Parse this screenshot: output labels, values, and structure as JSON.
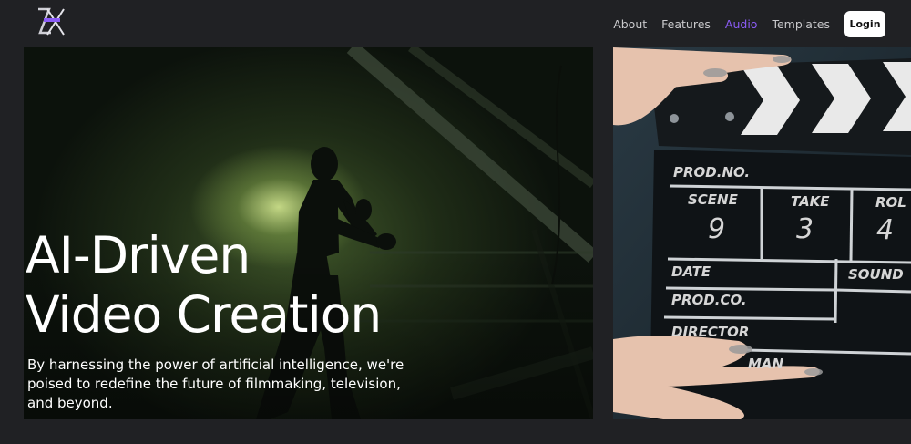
{
  "header": {
    "logo": {
      "icon": "zx-logo-icon",
      "text": "",
      "accent": "#8b5cf6"
    },
    "nav": [
      {
        "label": "About",
        "active": false
      },
      {
        "label": "Features",
        "active": false
      },
      {
        "label": "Audio",
        "active": true
      },
      {
        "label": "Templates",
        "active": false
      }
    ],
    "login_label": "Login"
  },
  "hero": {
    "title_line1": "AI-Driven",
    "title_line2": "Video Creation",
    "description": "By harnessing the power of artificial intelligence, we're poised to redefine the future of filmmaking, television, and beyond.",
    "image": "boxer-silhouette-image"
  },
  "clapboard": {
    "image": "film-clapperboard-image",
    "prod_no": "PROD.NO.",
    "scene_label": "SCENE",
    "take_label": "TAKE",
    "roll_label": "ROL",
    "scene_value": "9",
    "take_value": "3",
    "roll_value": "4",
    "date_label": "DATE",
    "sound_label": "SOUND",
    "prod_co": "PROD.CO.",
    "director": "DIRECTOR",
    "cameraman": "MAN"
  },
  "colors": {
    "background": "#202124",
    "active_nav": "#8b5cf6",
    "text": "#ffffff"
  }
}
